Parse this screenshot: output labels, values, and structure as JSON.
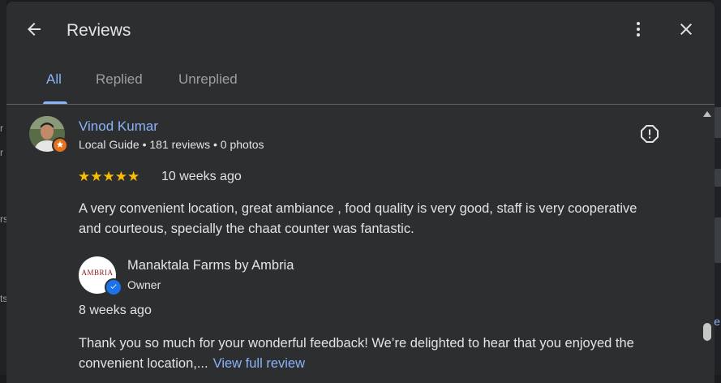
{
  "background": {
    "left_fragments": [
      "r",
      "r",
      "rs",
      "ts"
    ],
    "right_fragment": "e"
  },
  "header": {
    "title": "Reviews",
    "back_icon": "arrow-back-icon",
    "more_icon": "more-vert-icon",
    "close_icon": "close-icon"
  },
  "tabs": [
    {
      "label": "All",
      "active": true
    },
    {
      "label": "Replied",
      "active": false
    },
    {
      "label": "Unreplied",
      "active": false
    }
  ],
  "review": {
    "reviewer_name": "Vinod Kumar",
    "reviewer_meta": "Local Guide • 181 reviews • 0 photos",
    "stars": "★★★★★",
    "rating": 5,
    "date": "10 weeks ago",
    "text": "A very convenient location, great ambiance , food quality is very good, staff is very cooperative and courteous, specially the chaat counter was fantastic.",
    "report_icon": "report-icon"
  },
  "reply": {
    "owner_name": "Manaktala Farms by Ambria",
    "owner_role": "Owner",
    "logo_text": "AMBRIA",
    "date": "8 weeks ago",
    "text": "Thank you so much for your wonderful feedback! We’re delighted to hear that you enjoyed the convenient location,...",
    "view_full": "View full review"
  },
  "colors": {
    "accent": "#8ab4f8",
    "star": "#fbbc04",
    "surface": "#2d2e30",
    "guide_badge": "#e8711c",
    "verified": "#1a73e8"
  }
}
